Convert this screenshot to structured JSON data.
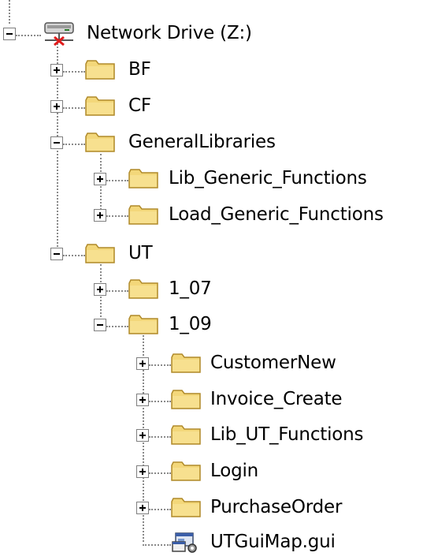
{
  "tree": {
    "root": {
      "label": "Network Drive (Z:)",
      "icon": "network-drive-icon",
      "expanded": true
    },
    "nodes": [
      {
        "label": "BF",
        "expanded": false
      },
      {
        "label": "CF",
        "expanded": false
      },
      {
        "label": "GeneralLibraries",
        "expanded": true
      },
      {
        "label": "Lib_Generic_Functions",
        "expanded": false
      },
      {
        "label": "Load_Generic_Functions",
        "expanded": false
      },
      {
        "label": "UT",
        "expanded": true
      },
      {
        "label": "1_07",
        "expanded": false
      },
      {
        "label": "1_09",
        "expanded": true
      },
      {
        "label": "CustomerNew",
        "expanded": false
      },
      {
        "label": "Invoice_Create",
        "expanded": false
      },
      {
        "label": "Lib_UT_Functions",
        "expanded": false
      },
      {
        "label": "Login",
        "expanded": false
      },
      {
        "label": "PurchaseOrder",
        "expanded": false
      },
      {
        "label": "UTGuiMap.gui",
        "icon": "gui-map-file-icon"
      }
    ]
  },
  "colors": {
    "folder_fill": "#f3d77a",
    "folder_dark": "#c9a53c",
    "connector": "#8a8a8a"
  }
}
